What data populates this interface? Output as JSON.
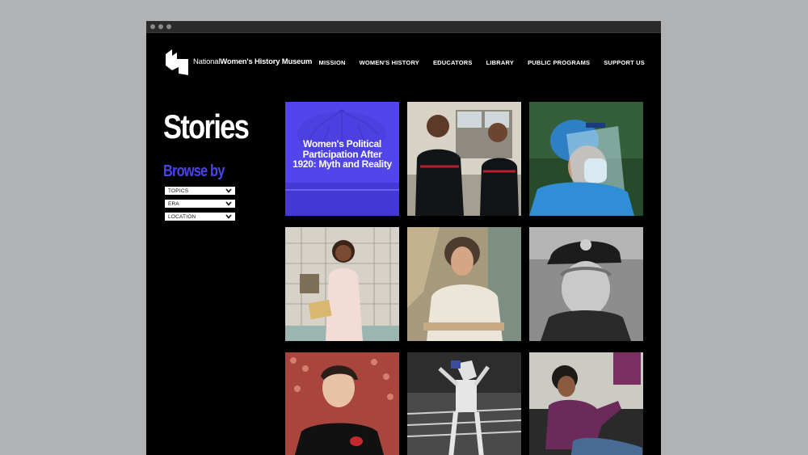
{
  "brand": {
    "name_prefix": "National",
    "name_main": "Women's History Museum",
    "logo_icon": "museum-logo-icon"
  },
  "nav": {
    "items": [
      {
        "label": "MISSION"
      },
      {
        "label": "WOMEN'S HISTORY"
      },
      {
        "label": "EDUCATORS"
      },
      {
        "label": "LIBRARY"
      },
      {
        "label": "PUBLIC PROGRAMS"
      },
      {
        "label": "SUPPORT US"
      }
    ]
  },
  "page": {
    "title": "Stories",
    "browse_heading": "Browse by"
  },
  "filters": [
    {
      "label": "TOPICS",
      "icon": "chevron-down-icon"
    },
    {
      "label": "ERA",
      "icon": "chevron-down-icon"
    },
    {
      "label": "LOCATION",
      "icon": "chevron-down-icon"
    }
  ],
  "stories": {
    "featured_caption": "Women's Political Participation After 1920: Myth and Reality"
  },
  "colors": {
    "accent": "#4b44e6",
    "background": "#000000",
    "page_outer": "#b1b2b4"
  }
}
